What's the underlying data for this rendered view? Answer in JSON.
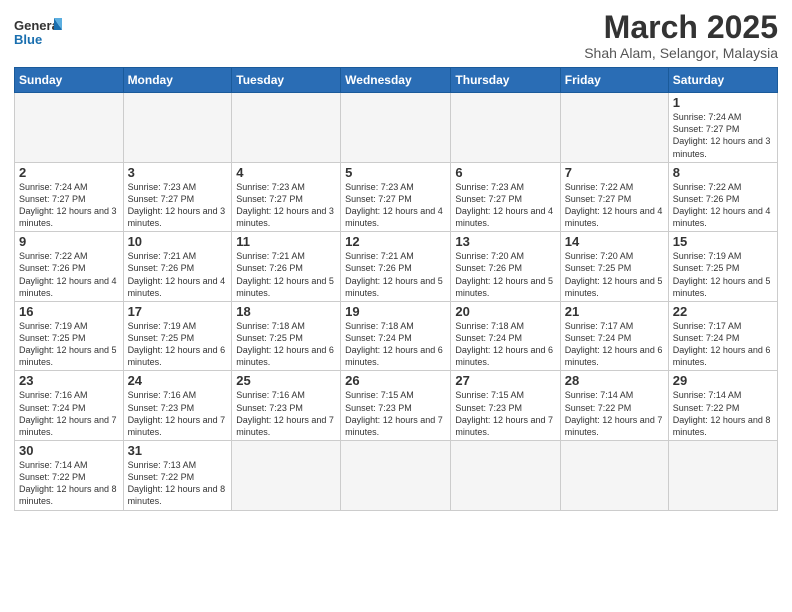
{
  "header": {
    "logo_general": "General",
    "logo_blue": "Blue",
    "title": "March 2025",
    "subtitle": "Shah Alam, Selangor, Malaysia"
  },
  "weekdays": [
    "Sunday",
    "Monday",
    "Tuesday",
    "Wednesday",
    "Thursday",
    "Friday",
    "Saturday"
  ],
  "weeks": [
    [
      {
        "day": "",
        "info": ""
      },
      {
        "day": "",
        "info": ""
      },
      {
        "day": "",
        "info": ""
      },
      {
        "day": "",
        "info": ""
      },
      {
        "day": "",
        "info": ""
      },
      {
        "day": "",
        "info": ""
      },
      {
        "day": "1",
        "info": "Sunrise: 7:24 AM\nSunset: 7:27 PM\nDaylight: 12 hours and 3 minutes."
      }
    ],
    [
      {
        "day": "2",
        "info": "Sunrise: 7:24 AM\nSunset: 7:27 PM\nDaylight: 12 hours and 3 minutes."
      },
      {
        "day": "3",
        "info": "Sunrise: 7:23 AM\nSunset: 7:27 PM\nDaylight: 12 hours and 3 minutes."
      },
      {
        "day": "4",
        "info": "Sunrise: 7:23 AM\nSunset: 7:27 PM\nDaylight: 12 hours and 3 minutes."
      },
      {
        "day": "5",
        "info": "Sunrise: 7:23 AM\nSunset: 7:27 PM\nDaylight: 12 hours and 4 minutes."
      },
      {
        "day": "6",
        "info": "Sunrise: 7:23 AM\nSunset: 7:27 PM\nDaylight: 12 hours and 4 minutes."
      },
      {
        "day": "7",
        "info": "Sunrise: 7:22 AM\nSunset: 7:27 PM\nDaylight: 12 hours and 4 minutes."
      },
      {
        "day": "8",
        "info": "Sunrise: 7:22 AM\nSunset: 7:26 PM\nDaylight: 12 hours and 4 minutes."
      }
    ],
    [
      {
        "day": "9",
        "info": "Sunrise: 7:22 AM\nSunset: 7:26 PM\nDaylight: 12 hours and 4 minutes."
      },
      {
        "day": "10",
        "info": "Sunrise: 7:21 AM\nSunset: 7:26 PM\nDaylight: 12 hours and 4 minutes."
      },
      {
        "day": "11",
        "info": "Sunrise: 7:21 AM\nSunset: 7:26 PM\nDaylight: 12 hours and 5 minutes."
      },
      {
        "day": "12",
        "info": "Sunrise: 7:21 AM\nSunset: 7:26 PM\nDaylight: 12 hours and 5 minutes."
      },
      {
        "day": "13",
        "info": "Sunrise: 7:20 AM\nSunset: 7:26 PM\nDaylight: 12 hours and 5 minutes."
      },
      {
        "day": "14",
        "info": "Sunrise: 7:20 AM\nSunset: 7:25 PM\nDaylight: 12 hours and 5 minutes."
      },
      {
        "day": "15",
        "info": "Sunrise: 7:19 AM\nSunset: 7:25 PM\nDaylight: 12 hours and 5 minutes."
      }
    ],
    [
      {
        "day": "16",
        "info": "Sunrise: 7:19 AM\nSunset: 7:25 PM\nDaylight: 12 hours and 5 minutes."
      },
      {
        "day": "17",
        "info": "Sunrise: 7:19 AM\nSunset: 7:25 PM\nDaylight: 12 hours and 6 minutes."
      },
      {
        "day": "18",
        "info": "Sunrise: 7:18 AM\nSunset: 7:25 PM\nDaylight: 12 hours and 6 minutes."
      },
      {
        "day": "19",
        "info": "Sunrise: 7:18 AM\nSunset: 7:24 PM\nDaylight: 12 hours and 6 minutes."
      },
      {
        "day": "20",
        "info": "Sunrise: 7:18 AM\nSunset: 7:24 PM\nDaylight: 12 hours and 6 minutes."
      },
      {
        "day": "21",
        "info": "Sunrise: 7:17 AM\nSunset: 7:24 PM\nDaylight: 12 hours and 6 minutes."
      },
      {
        "day": "22",
        "info": "Sunrise: 7:17 AM\nSunset: 7:24 PM\nDaylight: 12 hours and 6 minutes."
      }
    ],
    [
      {
        "day": "23",
        "info": "Sunrise: 7:16 AM\nSunset: 7:24 PM\nDaylight: 12 hours and 7 minutes."
      },
      {
        "day": "24",
        "info": "Sunrise: 7:16 AM\nSunset: 7:23 PM\nDaylight: 12 hours and 7 minutes."
      },
      {
        "day": "25",
        "info": "Sunrise: 7:16 AM\nSunset: 7:23 PM\nDaylight: 12 hours and 7 minutes."
      },
      {
        "day": "26",
        "info": "Sunrise: 7:15 AM\nSunset: 7:23 PM\nDaylight: 12 hours and 7 minutes."
      },
      {
        "day": "27",
        "info": "Sunrise: 7:15 AM\nSunset: 7:23 PM\nDaylight: 12 hours and 7 minutes."
      },
      {
        "day": "28",
        "info": "Sunrise: 7:14 AM\nSunset: 7:22 PM\nDaylight: 12 hours and 7 minutes."
      },
      {
        "day": "29",
        "info": "Sunrise: 7:14 AM\nSunset: 7:22 PM\nDaylight: 12 hours and 8 minutes."
      }
    ],
    [
      {
        "day": "30",
        "info": "Sunrise: 7:14 AM\nSunset: 7:22 PM\nDaylight: 12 hours and 8 minutes."
      },
      {
        "day": "31",
        "info": "Sunrise: 7:13 AM\nSunset: 7:22 PM\nDaylight: 12 hours and 8 minutes."
      },
      {
        "day": "",
        "info": ""
      },
      {
        "day": "",
        "info": ""
      },
      {
        "day": "",
        "info": ""
      },
      {
        "day": "",
        "info": ""
      },
      {
        "day": "",
        "info": ""
      }
    ]
  ]
}
